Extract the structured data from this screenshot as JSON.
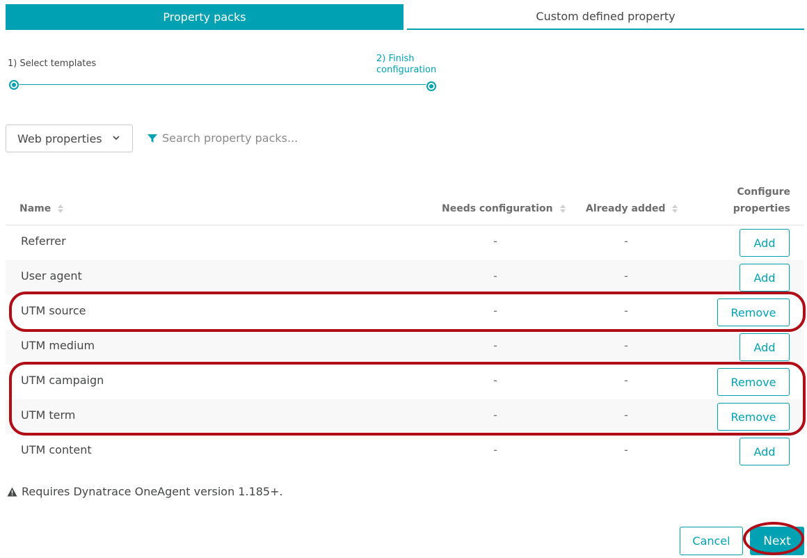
{
  "tabs": [
    {
      "label": "Property packs",
      "active": true
    },
    {
      "label": "Custom defined property",
      "active": false
    }
  ],
  "stepper": {
    "step1": "1) Select templates",
    "step2_line1": "2) Finish",
    "step2_line2": "configuration"
  },
  "filter": {
    "select_value": "Web properties",
    "search_placeholder": "Search property packs..."
  },
  "table": {
    "headers": {
      "name": "Name",
      "needs": "Needs configuration",
      "added": "Already added",
      "config_line1": "Configure",
      "config_line2": "properties"
    },
    "rows": [
      {
        "name": "Referrer",
        "needs": "-",
        "added": "-",
        "action": "Add"
      },
      {
        "name": "User agent",
        "needs": "-",
        "added": "-",
        "action": "Add"
      },
      {
        "name": "UTM source",
        "needs": "-",
        "added": "-",
        "action": "Remove"
      },
      {
        "name": "UTM medium",
        "needs": "-",
        "added": "-",
        "action": "Add"
      },
      {
        "name": "UTM campaign",
        "needs": "-",
        "added": "-",
        "action": "Remove"
      },
      {
        "name": "UTM term",
        "needs": "-",
        "added": "-",
        "action": "Remove"
      },
      {
        "name": "UTM content",
        "needs": "-",
        "added": "-",
        "action": "Add"
      }
    ]
  },
  "footer": {
    "note": "Requires Dynatrace OneAgent version 1.185+.",
    "cancel_label": "Cancel",
    "next_label": "Next"
  },
  "colors": {
    "accent": "#00a1b2",
    "highlight": "#b00d17"
  }
}
